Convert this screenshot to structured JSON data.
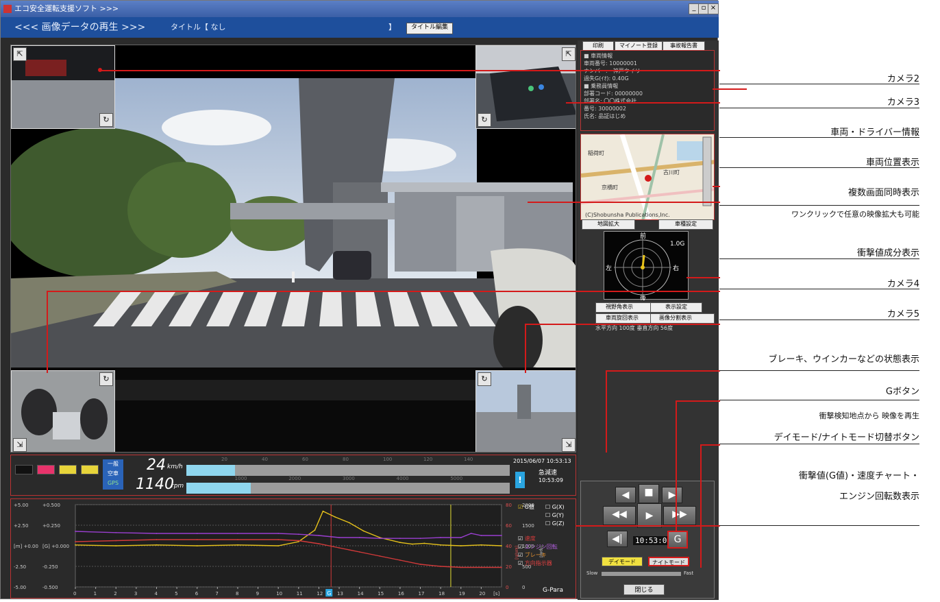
{
  "window": {
    "title": "エコ安全運転支援ソフト >>>"
  },
  "header": {
    "title": "<<< 画像データの再生 >>>",
    "title_label": "タイトル【 なし",
    "title_bracket_end": "】",
    "title_edit_button": "タイトル編集"
  },
  "top_buttons": {
    "print": "印刷",
    "my_note": "マイノート登録",
    "accident_report": "事故報告書"
  },
  "vehicle_info": {
    "section_vehicle": "■ 車両情報",
    "vehicle_no": "車両番号: 10000001",
    "plate": "ナンバー:　神戸ウイリ",
    "threshold": "過失G(ｲｵ): 0.40G",
    "section_driver": "■ 乗務員情報",
    "dept_code": "部署コード: 00000000",
    "dept_name": "部署名: 〇〇株式会社",
    "number": "番号: 30000002",
    "name": "氏名: 品証はじめ"
  },
  "map": {
    "copyright": "(C)Shobunsha Publications,Inc.",
    "zoom_button": "地図拡大",
    "vehicle_settings_button": "車種設定",
    "place_1": "稲荷町",
    "place_2": "古川町",
    "place_3": "京橋町"
  },
  "gforce": {
    "front": "前",
    "back": "後",
    "left": "左",
    "right": "右",
    "scale": "1.0G"
  },
  "gforce_options": {
    "view_angle": "視野角表示",
    "display_settings": "表示設定",
    "vehicle_turn": "車両旋回表示",
    "image_rotate": "画像分割表示",
    "angle_text": "水平方向 100度  垂直方向 56度"
  },
  "status": {
    "mode_top": "一般",
    "mode_mid": "空車",
    "mode_gps": "GPS",
    "speed_value": "24",
    "speed_unit": "km/h",
    "rpm_value": "1140",
    "rpm_unit": "rpm",
    "speed_fraction": 0.15,
    "rpm_fraction": 0.2,
    "datetime": "2015/06/07 10:53:13",
    "event_label": "急減速",
    "event_time": "10:53:09",
    "lamp_colors": [
      "#111111",
      "#e8336b",
      "#e7d43a",
      "#e7d43a"
    ],
    "speed_ticks": [
      "20",
      "40",
      "60",
      "80",
      "100",
      "120",
      "140"
    ],
    "rpm_ticks": [
      "1000",
      "2000",
      "3000",
      "4000",
      "5000"
    ]
  },
  "chart_left_axis": {
    "m_labels": [
      "+5.00",
      "+2.50",
      "[m] +0.00",
      "-2.50",
      "-5.00"
    ],
    "g_labels": [
      "+0.500",
      "+0.250",
      "[G] +0.000",
      "-0.250",
      "-0.500"
    ]
  },
  "chart_right_axis": {
    "speed_labels": [
      "80",
      "60",
      "40",
      "20",
      "0"
    ],
    "rpm_labels": [
      "2000",
      "1500",
      "1000",
      "500",
      "0"
    ],
    "speed_unit": "[km/h]",
    "rpm_unit": "[rpm]"
  },
  "chart_legend": {
    "g_value": "G値",
    "gx": "G(X)",
    "gy": "G(Y)",
    "gz": "G(Z)",
    "speed": "速度",
    "engine": "エンジン回転",
    "brake": "ブレーキ",
    "winker": "方向指示器",
    "g_para": "G-Para"
  },
  "chart_data": {
    "type": "line",
    "x_label": "[s]",
    "x_ticks": [
      "0",
      "1",
      "2",
      "3",
      "4",
      "5",
      "6",
      "7",
      "8",
      "9",
      "10",
      "11",
      "12",
      "13",
      "14",
      "15",
      "16",
      "17",
      "18",
      "19",
      "20"
    ],
    "highlight_tick": "G",
    "cursor_seconds": 18.5,
    "event_seconds": 12.6,
    "series": [
      {
        "name": "G値",
        "color": "#e7c21a",
        "axis": "g",
        "x": [
          0,
          2,
          4,
          6,
          8,
          10,
          11,
          11.8,
          12.2,
          12.8,
          13.5,
          14.2,
          15,
          16,
          16.6,
          17.2,
          18,
          19,
          20,
          21
        ],
        "y": [
          0.01,
          0.0,
          0.01,
          0.0,
          0.01,
          0.0,
          0.05,
          0.19,
          0.42,
          0.35,
          0.28,
          0.18,
          0.1,
          0.04,
          0.02,
          0.03,
          0.01,
          0.0,
          0.01,
          0.0
        ]
      },
      {
        "name": "速度",
        "color": "#d43a3a",
        "axis": "speed",
        "x": [
          0,
          2,
          4,
          6,
          8,
          10,
          11,
          12,
          13,
          14,
          15,
          16,
          17,
          18,
          19,
          20,
          21
        ],
        "y": [
          44,
          45,
          46,
          46,
          46,
          46,
          45,
          42,
          38,
          34,
          30,
          26,
          22,
          20,
          19,
          19,
          19
        ]
      },
      {
        "name": "エンジン回転",
        "color": "#9a3fd0",
        "axis": "rpm",
        "x": [
          0,
          2,
          4,
          6,
          8,
          10,
          11,
          12,
          13,
          14,
          15,
          16,
          17,
          18,
          19,
          19.5,
          20,
          21
        ],
        "y": [
          1350,
          1320,
          1300,
          1300,
          1300,
          1300,
          1280,
          1250,
          1200,
          1200,
          1180,
          1180,
          1180,
          1200,
          1200,
          1300,
          1250,
          1250
        ]
      }
    ]
  },
  "controls": {
    "time": "10:53:04",
    "g_button": "G",
    "day_mode": "デイモード",
    "night_mode": "ナイトモード",
    "slow": "Slow",
    "fast": "Fast",
    "close": "閉じる"
  },
  "annotations": {
    "camera2": "カメラ2",
    "camera3": "カメラ3",
    "vehicle_driver": "車両・ドライバー情報",
    "position": "車両位置表示",
    "multi_screen": "複数画面同時表示",
    "multi_screen_sub": "ワンクリックで任意の映像拡大も可能",
    "impact_component": "衝撃値成分表示",
    "camera4": "カメラ4",
    "camera5": "カメラ5",
    "status_display": "ブレーキ、ウインカーなどの状態表示",
    "g_button": "Gボタン",
    "g_button_sub": "衝撃検知地点から 映像を再生",
    "day_night": "デイモード/ナイトモード切替ボタン",
    "chart_line1": "衝撃値(G値)・速度チャート・",
    "chart_line2": "エンジン回転数表示"
  }
}
